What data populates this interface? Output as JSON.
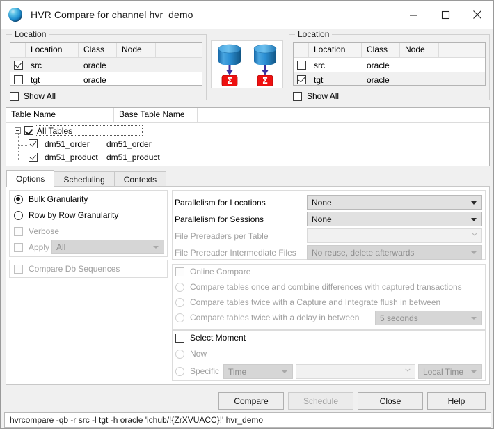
{
  "window": {
    "title": "HVR Compare for channel hvr_demo",
    "icon": "hvr-globe-icon",
    "controls": {
      "minimize": "minimize-icon",
      "maximize": "maximize-icon",
      "close": "close-icon"
    }
  },
  "location_left": {
    "group_title": "Location",
    "columns": [
      "",
      "Location",
      "Class",
      "Node",
      ""
    ],
    "rows": [
      {
        "checked": true,
        "selected": true,
        "location": "src",
        "class": "oracle",
        "node": ""
      },
      {
        "checked": false,
        "selected": false,
        "location": "tgt",
        "class": "oracle",
        "node": ""
      }
    ],
    "show_all_label": "Show All",
    "show_all_checked": false
  },
  "location_right": {
    "group_title": "Location",
    "columns": [
      "",
      "Location",
      "Class",
      "Node",
      ""
    ],
    "rows": [
      {
        "checked": false,
        "selected": false,
        "location": "src",
        "class": "oracle",
        "node": ""
      },
      {
        "checked": true,
        "selected": true,
        "location": "tgt",
        "class": "oracle",
        "node": ""
      }
    ],
    "show_all_label": "Show All",
    "show_all_checked": false
  },
  "center_graphic": {
    "name": "compare-databases-graphic",
    "units": 2,
    "database_color": "#2b8fd4",
    "sigma_color": "#ee1111",
    "sigma_glyph": "Σ",
    "arrow_color": "#3b2f9e"
  },
  "tables_tree": {
    "columns": [
      "Table Name",
      "Base Table Name",
      ""
    ],
    "root": {
      "label": "All Tables",
      "checked": true,
      "expanded": true,
      "selected": true
    },
    "children": [
      {
        "checked": true,
        "table_name": "dm51_order",
        "base_table_name": "dm51_order"
      },
      {
        "checked": true,
        "table_name": "dm51_product",
        "base_table_name": "dm51_product"
      }
    ]
  },
  "tabs": {
    "items": [
      {
        "label": "Options",
        "active": true
      },
      {
        "label": "Scheduling",
        "active": false
      },
      {
        "label": "Contexts",
        "active": false
      }
    ]
  },
  "options": {
    "granularity": {
      "bulk": {
        "label": "Bulk Granularity",
        "selected": true,
        "disabled": false
      },
      "row_by_row": {
        "label": "Row by Row Granularity",
        "selected": false,
        "disabled": false
      }
    },
    "verbose": {
      "label": "Verbose",
      "checked": false,
      "disabled": true
    },
    "apply": {
      "label": "Apply",
      "checked": false,
      "disabled": true,
      "value": "All"
    },
    "compare_db_sequences": {
      "label": "Compare Db Sequences",
      "checked": false,
      "disabled": true
    },
    "parallelism_locations": {
      "label": "Parallelism for Locations",
      "value": "None",
      "disabled": false
    },
    "parallelism_sessions": {
      "label": "Parallelism for Sessions",
      "value": "None",
      "disabled": false
    },
    "file_prereaders_per_table": {
      "label": "File Prereaders per Table",
      "value": "",
      "disabled": true
    },
    "file_prereader_intermediate_files": {
      "label": "File Prereader Intermediate Files",
      "value": "No reuse, delete afterwards",
      "disabled": true
    },
    "online_compare": {
      "label": "Online Compare",
      "checked": false,
      "disabled": true,
      "choices": [
        {
          "label": "Compare tables once and combine differences with captured transactions",
          "selected": false,
          "disabled": true
        },
        {
          "label": "Compare tables twice with a Capture and Integrate flush in between",
          "selected": false,
          "disabled": true
        },
        {
          "label": "Compare tables twice with a delay in between",
          "selected": false,
          "disabled": true
        }
      ],
      "delay_value": "5 seconds"
    },
    "select_moment": {
      "label": "Select Moment",
      "checked": false,
      "disabled": false,
      "now": {
        "label": "Now",
        "selected": false,
        "disabled": true
      },
      "specific": {
        "label": "Specific",
        "selected": false,
        "disabled": true
      },
      "specific_type": "Time",
      "specific_value": "",
      "timezone": "Local Time"
    }
  },
  "buttons": {
    "compare": {
      "label": "Compare",
      "disabled": false
    },
    "schedule": {
      "label": "Schedule",
      "disabled": true
    },
    "close": {
      "label": "Close",
      "mnemonic": "C",
      "disabled": false
    },
    "help": {
      "label": "Help",
      "disabled": false
    }
  },
  "status_bar": {
    "command": "hvrcompare -qb -r src -l tgt -h oracle 'ichub/!{ZrXVUACC}!' hvr_demo"
  }
}
